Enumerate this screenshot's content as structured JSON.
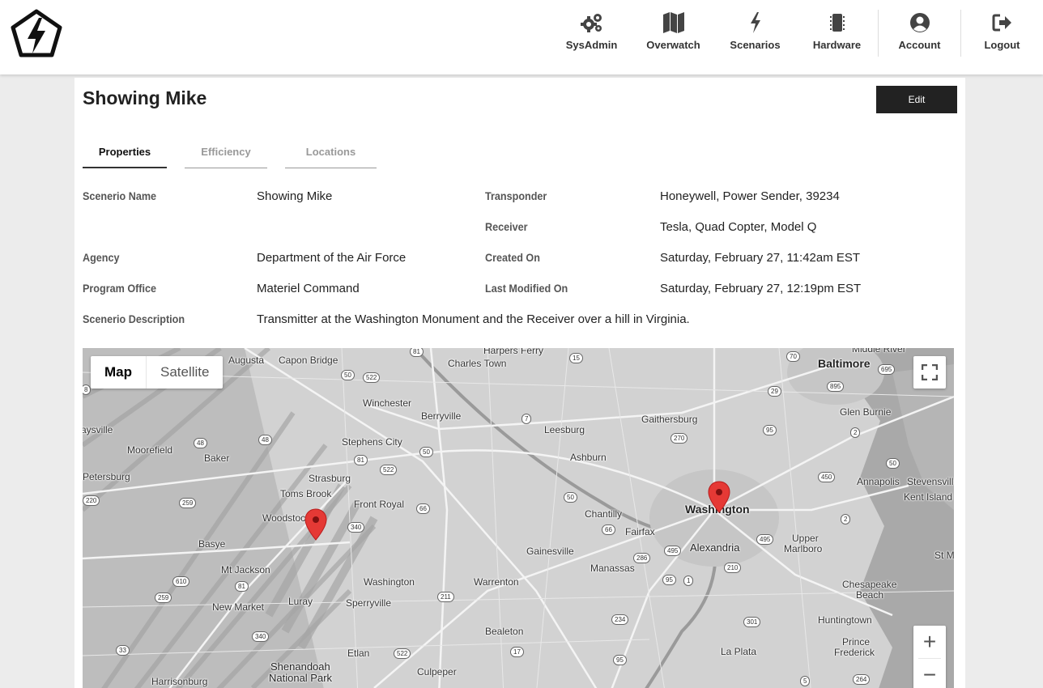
{
  "nav": {
    "items": [
      {
        "label": "SysAdmin",
        "icon": "gears-icon"
      },
      {
        "label": "Overwatch",
        "icon": "map-icon"
      },
      {
        "label": "Scenarios",
        "icon": "bolt-icon"
      },
      {
        "label": "Hardware",
        "icon": "chip-icon"
      },
      {
        "label": "Account",
        "icon": "user-icon"
      },
      {
        "label": "Logout",
        "icon": "logout-icon"
      }
    ]
  },
  "page": {
    "title": "Showing Mike",
    "edit_label": "Edit"
  },
  "tabs": [
    {
      "label": "Properties",
      "active": true
    },
    {
      "label": "Efficiency",
      "active": false
    },
    {
      "label": "Locations",
      "active": false
    }
  ],
  "properties": {
    "scenerio_name_label": "Scenerio Name",
    "scenerio_name": "Showing Mike",
    "agency_label": "Agency",
    "agency": "Department of the Air Force",
    "program_office_label": "Program Office",
    "program_office": "Materiel Command",
    "description_label": "Scenerio Description",
    "description": "Transmitter at the Washington Monument and the Receiver over a hill in Virginia.",
    "transponder_label": "Transponder",
    "transponder": "Honeywell, Power Sender, 39234",
    "receiver_label": "Receiver",
    "receiver": "Tesla, Quad Copter, Model Q",
    "created_label": "Created On",
    "created": "Saturday, February 27, 11:42am EST",
    "modified_label": "Last Modified On",
    "modified": "Saturday, February 27, 12:19pm EST"
  },
  "map": {
    "type_map": "Map",
    "type_satellite": "Satellite",
    "zoom_in": "+",
    "zoom_out": "−",
    "places": {
      "augusta": "Augusta",
      "capon_bridge": "Capon Bridge",
      "harpers_ferry": "Harpers Ferry",
      "charles_town": "Charles Town",
      "baltimore": "Baltimore",
      "winchester": "Winchester",
      "berryville": "Berryville",
      "leesburg": "Leesburg",
      "gaithersburg": "Gaithersburg",
      "glen_burnie": "Glen Burnie",
      "moorefield": "Moorefield",
      "baker": "Baker",
      "stephens_city": "Stephens City",
      "ashburn": "Ashburn",
      "petersburg": "Petersburg",
      "strasburg": "Strasburg",
      "annapolis": "Annapolis",
      "stevensville": "Stevensville",
      "toms_brook": "Toms Brook",
      "front_royal": "Front Royal",
      "chantilly": "Chantilly",
      "washington": "Washington",
      "kent_island": "Kent Island",
      "woodstock": "Woodstoc",
      "fairfax": "Fairfax",
      "basye": "Basye",
      "gainesville": "Gainesville",
      "alexandria": "Alexandria",
      "upper_marlboro_1": "Upper",
      "upper_marlboro_2": "Marlboro",
      "st_m": "St M",
      "mt_jackson": "Mt Jackson",
      "manassas": "Manassas",
      "washington_va": "Washington",
      "warrenton": "Warrenton",
      "chesapeake_1": "Chesapeake",
      "chesapeake_2": "Beach",
      "luray": "Luray",
      "sperryville": "Sperryville",
      "new_market": "New Market",
      "huntingtown": "Huntingtown",
      "bealeton": "Bealeton",
      "prince_frederick_1": "Prince",
      "prince_frederick_2": "Frederick",
      "la_plata": "La Plata",
      "etlan": "Etlan",
      "shenandoah_1": "Shenandoah",
      "shenandoah_2": "National Park",
      "harrisonburg": "Harrisonburg",
      "culpeper": "Culpeper",
      "middle_river": "Middle River",
      "waysville": "aysville"
    },
    "shields": [
      "81",
      "15",
      "70",
      "695",
      "50",
      "522",
      "29",
      "895",
      "8",
      "7",
      "270",
      "95",
      "48",
      "48",
      "50",
      "2",
      "81",
      "522",
      "50",
      "450",
      "220",
      "259",
      "50",
      "66",
      "2",
      "340",
      "66",
      "495",
      "495",
      "286",
      "210",
      "81",
      "95",
      "1",
      "610",
      "259",
      "211",
      "234",
      "301",
      "340",
      "33",
      "522",
      "17",
      "95",
      "264",
      "5"
    ]
  }
}
